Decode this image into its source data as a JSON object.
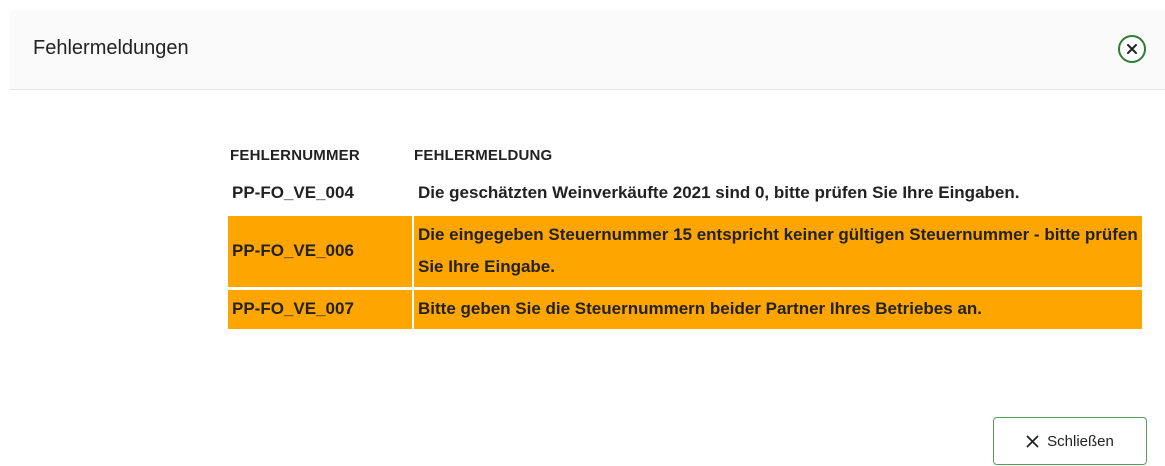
{
  "dialog": {
    "title": "Fehlermeldungen",
    "close_icon": "close-circle-icon"
  },
  "table": {
    "headers": [
      "FEHLERNUMMER",
      "FEHLERMELDUNG"
    ],
    "rows": [
      {
        "code": "PP-FO_VE_004",
        "message": "Die geschätzten Weinverkäufte 2021 sind 0, bitte prüfen Sie Ihre Eingaben.",
        "highlighted": false
      },
      {
        "code": "PP-FO_VE_006",
        "message": "Die eingegeben Steuernummer 15 entspricht keiner gültigen Steuernummer - bitte prüfen Sie Ihre Eingabe.",
        "highlighted": true
      },
      {
        "code": "PP-FO_VE_007",
        "message": "Bitte geben Sie die Steuernummern beider Partner Ihres Betriebes an.",
        "highlighted": true
      }
    ]
  },
  "footer": {
    "close_label": "Schließen",
    "close_icon": "x-icon"
  },
  "colors": {
    "highlight": "#ffa500",
    "accent": "#2e7d32"
  }
}
